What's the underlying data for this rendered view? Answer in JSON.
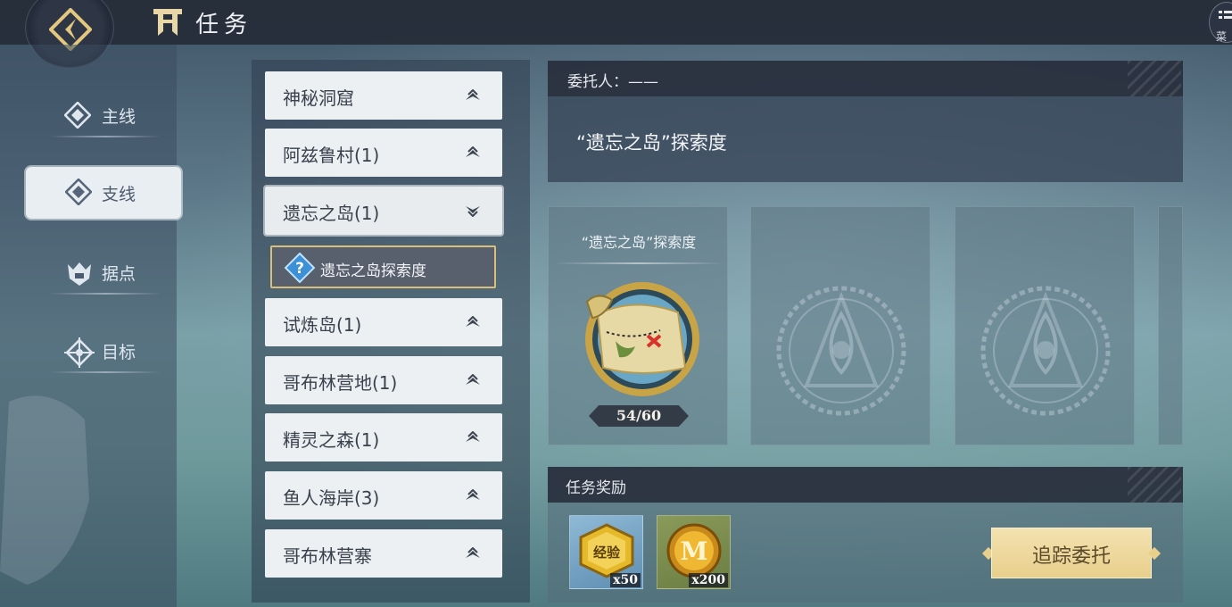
{
  "header": {
    "title": "任务",
    "menu_label": "菜"
  },
  "sidebar": {
    "items": [
      {
        "label": "主线",
        "icon": "diamond-icon"
      },
      {
        "label": "支线",
        "icon": "diamond-icon",
        "active": true
      },
      {
        "label": "据点",
        "icon": "stronghold-icon"
      },
      {
        "label": "目标",
        "icon": "crosshair-icon"
      }
    ]
  },
  "quest_list": {
    "groups": [
      {
        "label": "神秘洞窟",
        "state": "collapsed"
      },
      {
        "label": "阿兹鲁村(1)",
        "state": "collapsed"
      },
      {
        "label": "遗忘之岛(1)",
        "state": "expanded"
      },
      {
        "label": "试炼岛(1)",
        "state": "collapsed"
      },
      {
        "label": "哥布林营地(1)",
        "state": "collapsed"
      },
      {
        "label": "精灵之森(1)",
        "state": "collapsed"
      },
      {
        "label": "鱼人海岸(3)",
        "state": "collapsed"
      },
      {
        "label": "哥布林营寨",
        "state": "collapsed"
      }
    ],
    "selected_subitem": {
      "label": "遗忘之岛探索度",
      "icon": "question-icon"
    }
  },
  "detail": {
    "client_label": "委托人：——",
    "quest_title": "“遗忘之岛”探索度",
    "card": {
      "title": "“遗忘之岛”探索度",
      "progress": "54/60",
      "icon": "treasure-map-icon"
    },
    "reward_header": "任务奖励",
    "rewards": [
      {
        "name": "经验",
        "count": "x50",
        "icon": "exp-badge-icon"
      },
      {
        "name": "M",
        "count": "x200",
        "icon": "coin-icon"
      }
    ],
    "track_button": "追踪委托"
  },
  "colors": {
    "accent_gold": "#e8cf8c",
    "panel_dark": "#282e3c",
    "list_item": "#edf0f3"
  }
}
